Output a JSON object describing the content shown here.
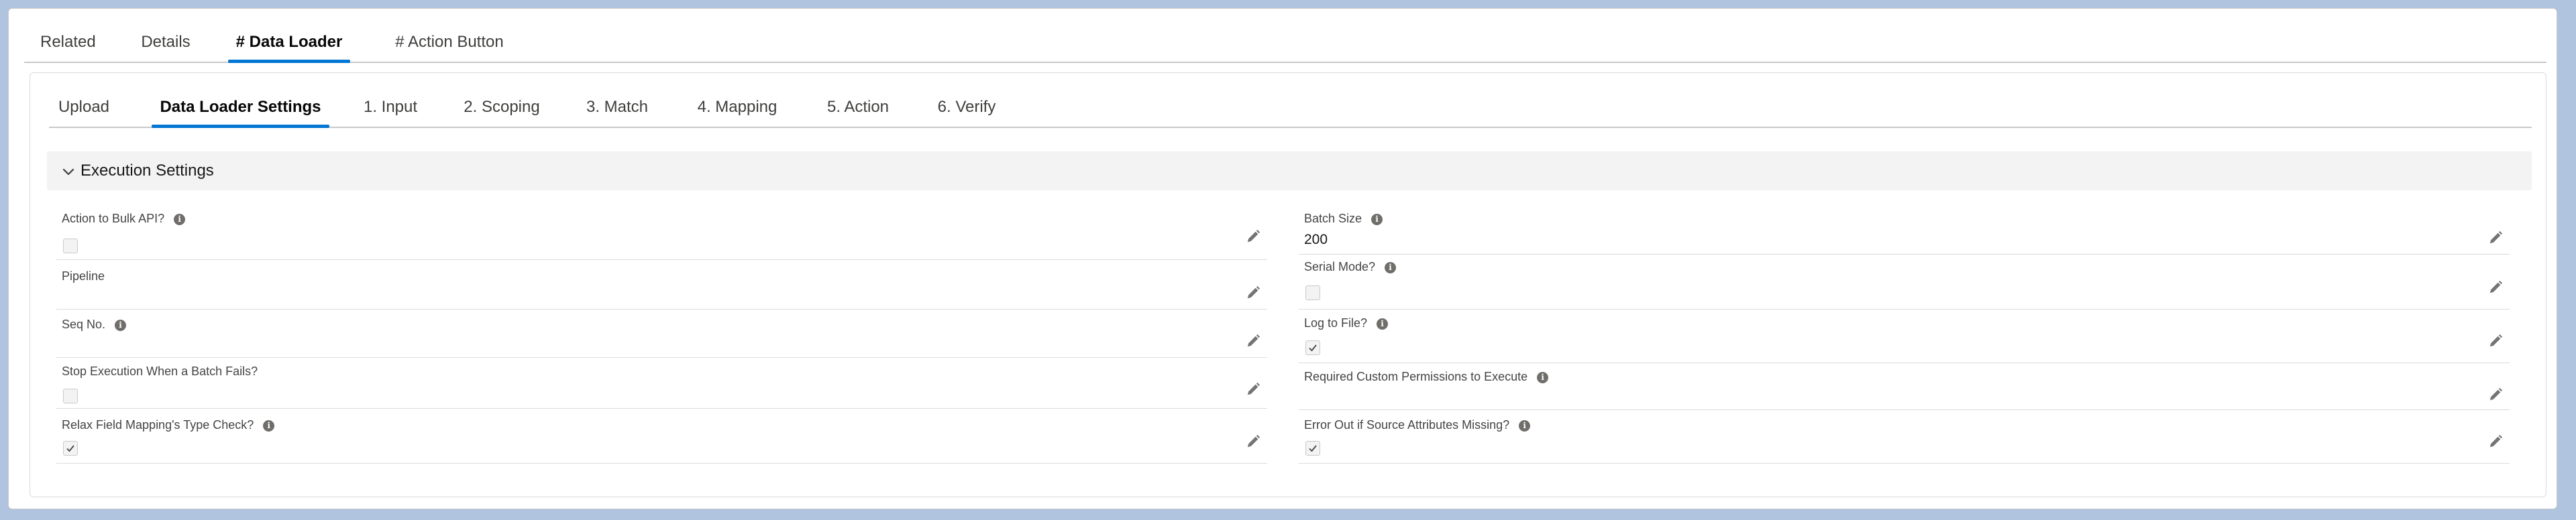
{
  "top_tabs": [
    {
      "label": "Related",
      "active": false
    },
    {
      "label": "Details",
      "active": false
    },
    {
      "label": "# Data Loader",
      "active": true
    },
    {
      "label": "# Action Button",
      "active": false
    }
  ],
  "inner_tabs": [
    {
      "label": "Upload",
      "active": false
    },
    {
      "label": "Data Loader Settings",
      "active": true
    },
    {
      "label": "1. Input",
      "active": false
    },
    {
      "label": "2. Scoping",
      "active": false
    },
    {
      "label": "3. Match",
      "active": false
    },
    {
      "label": "4. Mapping",
      "active": false
    },
    {
      "label": "5. Action",
      "active": false
    },
    {
      "label": "6. Verify",
      "active": false
    }
  ],
  "section": {
    "title": "Execution Settings",
    "expanded": true
  },
  "left_fields": [
    {
      "label": "Action to Bulk API?",
      "info": true,
      "type": "checkbox",
      "checked": false
    },
    {
      "label": "Pipeline",
      "info": false,
      "type": "text",
      "value": ""
    },
    {
      "label": "Seq No.",
      "info": true,
      "type": "text",
      "value": ""
    },
    {
      "label": "Stop Execution When a Batch Fails?",
      "info": false,
      "type": "checkbox",
      "checked": false
    },
    {
      "label": "Relax Field Mapping's Type Check?",
      "info": true,
      "type": "checkbox",
      "checked": true
    }
  ],
  "right_fields": [
    {
      "label": "Batch Size",
      "info": true,
      "type": "text",
      "value": "200"
    },
    {
      "label": "Serial Mode?",
      "info": true,
      "type": "checkbox",
      "checked": false
    },
    {
      "label": "Log to File?",
      "info": true,
      "type": "checkbox",
      "checked": true
    },
    {
      "label": "Required Custom Permissions to Execute",
      "info": true,
      "type": "text",
      "value": ""
    },
    {
      "label": "Error Out if Source Attributes Missing?",
      "info": true,
      "type": "checkbox",
      "checked": true
    }
  ],
  "icons": {
    "info": "info-icon",
    "edit": "pencil-icon",
    "check": "checkmark-icon",
    "chevron": "chevron-down-icon"
  },
  "colors": {
    "accent": "#0176d3",
    "background": "#b0c4df"
  }
}
